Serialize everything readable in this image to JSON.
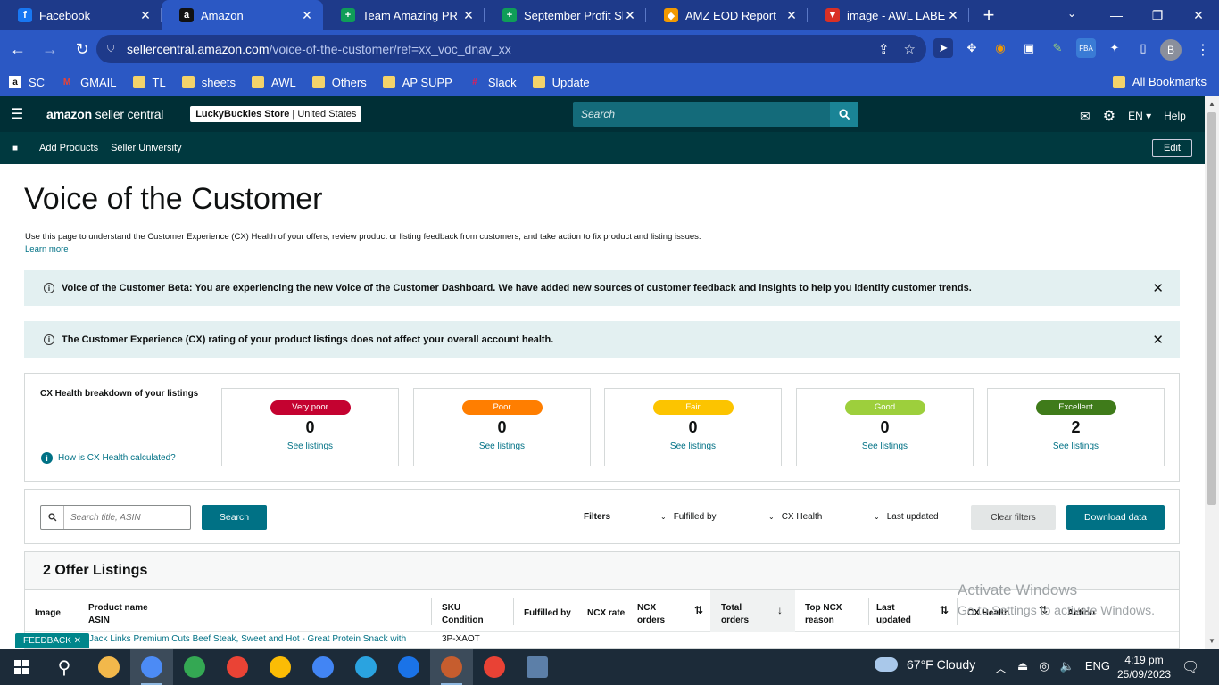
{
  "browser": {
    "tabs": [
      {
        "title": "Facebook",
        "icon": "f",
        "color": "#1877f2",
        "active": false
      },
      {
        "title": "Amazon",
        "icon": "a",
        "color": "#111111",
        "active": true
      },
      {
        "title": "Team Amazing PR - G",
        "icon": "+",
        "color": "#0f9d58",
        "active": false
      },
      {
        "title": "September Profit She",
        "icon": "+",
        "color": "#0f9d58",
        "active": false
      },
      {
        "title": "AMZ EOD Report",
        "icon": "◆",
        "color": "#f29900",
        "active": false
      },
      {
        "title": "image - AWL LABEL",
        "icon": "▼",
        "color": "#d93025",
        "active": false
      }
    ],
    "url_host": "sellercentral.amazon.com",
    "url_path": "/voice-of-the-customer/ref=xx_voc_dnav_xx",
    "profile_initial": "B",
    "bookmarks": [
      {
        "label": "SC",
        "icon": "a",
        "kind": "amazon"
      },
      {
        "label": "GMAIL",
        "icon": "M",
        "kind": "gmail"
      },
      {
        "label": "TL",
        "icon": "",
        "kind": "folder"
      },
      {
        "label": "sheets",
        "icon": "",
        "kind": "folder"
      },
      {
        "label": "AWL",
        "icon": "",
        "kind": "folder"
      },
      {
        "label": "Others",
        "icon": "",
        "kind": "folder"
      },
      {
        "label": "AP SUPP",
        "icon": "",
        "kind": "folder"
      },
      {
        "label": "Slack",
        "icon": "#",
        "kind": "slack"
      },
      {
        "label": "Update",
        "icon": "",
        "kind": "folder"
      }
    ],
    "all_bookmarks": "All Bookmarks"
  },
  "sc": {
    "logo_prefix": "amazon",
    "logo_suffix": " seller central",
    "store_name": "LuckyBuckles Store",
    "store_sep": " | ",
    "store_region": "United States",
    "search_placeholder": "Search",
    "lang": "EN",
    "help": "Help",
    "subnav": [
      "Add Products",
      "Seller University"
    ],
    "edit": "Edit"
  },
  "page": {
    "title": "Voice of the Customer",
    "description": "Use this page to understand the Customer Experience (CX) Health of your offers, review product or listing feedback from customers, and take action to fix product and listing issues.",
    "learn_more": "Learn more",
    "alert1": "Voice of the Customer Beta: You are experiencing the new Voice of the Customer Dashboard. We have added new sources of customer feedback and insights to help you identify customer trends.",
    "alert2": "The Customer Experience (CX) rating of your product listings does not affect your overall account health.",
    "cx_title": "CX Health breakdown of your listings",
    "cx_how": "How is CX Health calculated?",
    "cx_cards": [
      {
        "label": "Very poor",
        "count": "0",
        "color": "#c40230",
        "text_color": "#ffffff"
      },
      {
        "label": "Poor",
        "count": "0",
        "color": "#ff7e00",
        "text_color": "#ffffff"
      },
      {
        "label": "Fair",
        "count": "0",
        "color": "#fcc400",
        "text_color": "#ffffff"
      },
      {
        "label": "Good",
        "count": "0",
        "color": "#9dcf3c",
        "text_color": "#ffffff"
      },
      {
        "label": "Excellent",
        "count": "2",
        "color": "#3f7b1a",
        "text_color": "#ffffff"
      }
    ],
    "see_listings": "See listings",
    "search_placeholder": "Search title, ASIN",
    "search_button": "Search",
    "filters_label": "Filters",
    "filter_fulfilled": "Fulfilled by",
    "filter_cx": "CX Health",
    "filter_updated": "Last updated",
    "clear_filters": "Clear filters",
    "download": "Download data",
    "listings_title": "2 Offer Listings",
    "columns": {
      "image": "Image",
      "product": "Product name",
      "asin": "ASIN",
      "sku": "SKU",
      "condition": "Condition",
      "fulfilled": "Fulfilled by",
      "ncx_rate": "NCX rate",
      "ncx_orders_1": "NCX",
      "ncx_orders_2": "orders",
      "total_1": "Total",
      "total_2": "orders",
      "top_ncx_1": "Top NCX",
      "top_ncx_2": "reason",
      "updated_1": "Last",
      "updated_2": "updated",
      "cx_health": "CX Health",
      "action": "Action"
    },
    "first_row_product": "Jack Links Premium Cuts Beef Steak, Sweet and Hot - Great Protein Snack with",
    "first_row_sku": "3P-XAOT",
    "feedback": "FEEDBACK ✕"
  },
  "watermark": {
    "line1": "Activate Windows",
    "line2": "Go to Settings to activate Windows."
  },
  "taskbar": {
    "apps": [
      {
        "name": "file-explorer",
        "color": "#f2b84b",
        "active": false
      },
      {
        "name": "chrome-profile-b",
        "color": "#4c8bf5",
        "active": true
      },
      {
        "name": "chrome-profile-j",
        "color": "#34a853",
        "active": false
      },
      {
        "name": "chrome-profile-m",
        "color": "#ea4335",
        "active": false
      },
      {
        "name": "chrome-profile-g",
        "color": "#fbbc05",
        "active": false
      },
      {
        "name": "chrome-profile-r",
        "color": "#4285f4",
        "active": false
      },
      {
        "name": "telegram",
        "color": "#2aa3e0",
        "active": false
      },
      {
        "name": "zoom",
        "color": "#1a73e8",
        "active": false
      },
      {
        "name": "discord-like",
        "color": "#c65d2e",
        "active": true
      },
      {
        "name": "chrome-profile-s",
        "color": "#e94235",
        "active": false
      },
      {
        "name": "calculator",
        "color": "#5c7fa8",
        "active": false
      }
    ],
    "weather": "67°F  Cloudy",
    "lang": "ENG",
    "time": "4:19 pm",
    "date": "25/09/2023"
  }
}
